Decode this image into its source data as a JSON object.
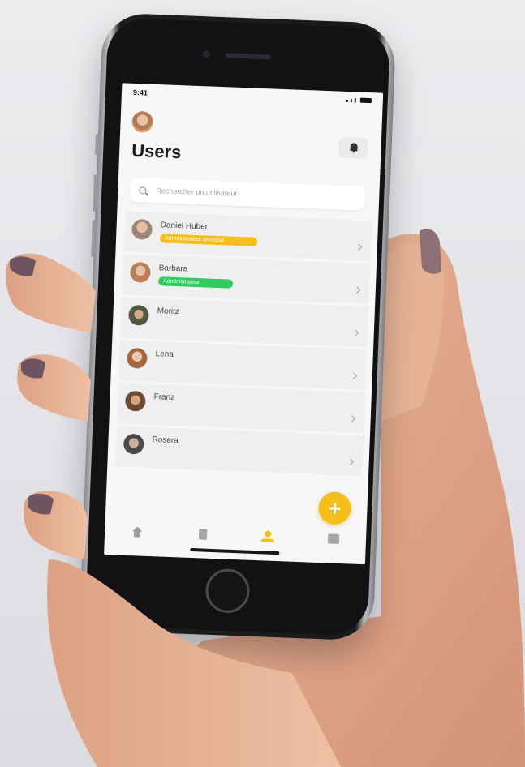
{
  "status_bar": {
    "time": "9:41"
  },
  "header": {
    "title": "Users",
    "bell_icon": "bell-icon"
  },
  "search": {
    "placeholder": "Rechercher un utilisateur"
  },
  "users": [
    {
      "name": "Daniel Huber",
      "badge": "Administrateur principal",
      "badge_color": "#f5be1b"
    },
    {
      "name": "Barbara",
      "badge": "Administrateur",
      "badge_color": "#2ecc5f"
    },
    {
      "name": "Moritz"
    },
    {
      "name": "Lena"
    },
    {
      "name": "Franz"
    },
    {
      "name": "Rosera"
    }
  ],
  "fab": {
    "label": "+"
  },
  "tab_bar": {
    "items": [
      "home-icon",
      "document-icon",
      "user-icon",
      "box-icon"
    ],
    "active": "user-icon"
  },
  "colors": {
    "accent": "#f5be1b",
    "green": "#2ecc5f",
    "screen_bg": "#f7f7f7"
  }
}
